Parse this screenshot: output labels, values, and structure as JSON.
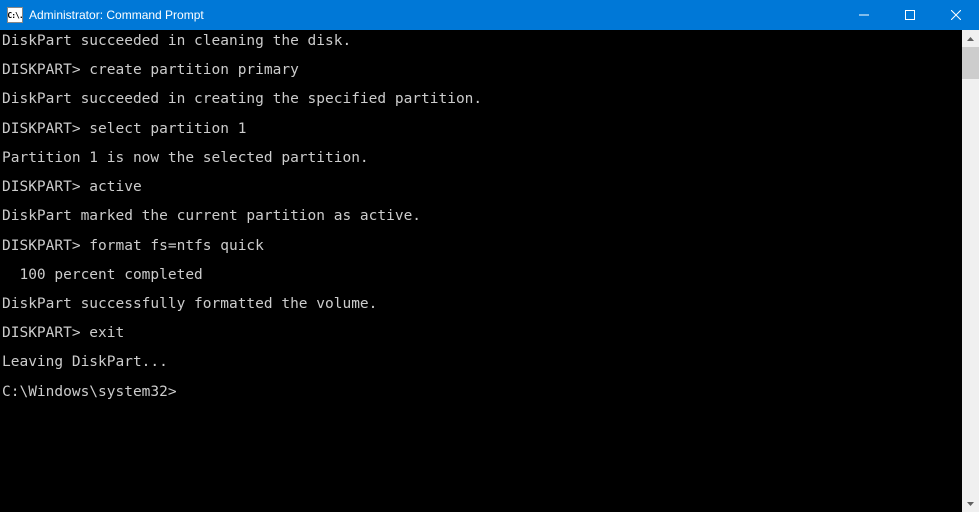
{
  "window": {
    "title": "Administrator: Command Prompt",
    "icon_text": "C:\\."
  },
  "terminal": {
    "lines": [
      "DiskPart succeeded in cleaning the disk.",
      "DISKPART> create partition primary",
      "DiskPart succeeded in creating the specified partition.",
      "DISKPART> select partition 1",
      "Partition 1 is now the selected partition.",
      "DISKPART> active",
      "DiskPart marked the current partition as active.",
      "DISKPART> format fs=ntfs quick",
      "  100 percent completed",
      "DiskPart successfully formatted the volume.",
      "DISKPART> exit",
      "Leaving DiskPart...",
      "C:\\Windows\\system32>"
    ]
  }
}
